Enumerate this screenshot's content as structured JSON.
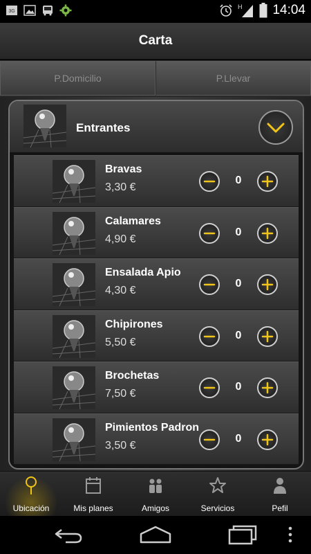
{
  "status_bar": {
    "time": "14:04",
    "left_icons": [
      "3g-badge-icon",
      "image-icon",
      "bus-icon",
      "gear-icon"
    ],
    "right_icons": [
      "alarm-icon",
      "signal-icon",
      "battery-icon"
    ],
    "network": "H"
  },
  "header": {
    "title": "Carta"
  },
  "tabs": [
    {
      "label": "P.Domicilio"
    },
    {
      "label": "P.Llevar"
    }
  ],
  "category": {
    "label": "Entrantes",
    "toggle_icon": "chevron-down-icon"
  },
  "items": [
    {
      "name": "Bravas",
      "price": "3,30 €",
      "qty": "0"
    },
    {
      "name": "Calamares",
      "price": "4,90 €",
      "qty": "0"
    },
    {
      "name": "Ensalada Apio",
      "price": "4,30 €",
      "qty": "0"
    },
    {
      "name": "Chipirones",
      "price": "5,50 €",
      "qty": "0"
    },
    {
      "name": "Brochetas",
      "price": "7,50 €",
      "qty": "0"
    },
    {
      "name": "Pimientos Padron",
      "price": "3,50 €",
      "qty": "0"
    }
  ],
  "bottom_nav": [
    {
      "label": "Ubicación",
      "icon": "pin-icon",
      "active": true
    },
    {
      "label": "Mis planes",
      "icon": "calendar-icon",
      "active": false
    },
    {
      "label": "Amigos",
      "icon": "people-icon",
      "active": false
    },
    {
      "label": "Servicios",
      "icon": "star-icon",
      "active": false
    },
    {
      "label": "Pefil",
      "icon": "user-icon",
      "active": false
    }
  ],
  "colors": {
    "accent": "#f0c419",
    "background": "#2a2a2a"
  }
}
